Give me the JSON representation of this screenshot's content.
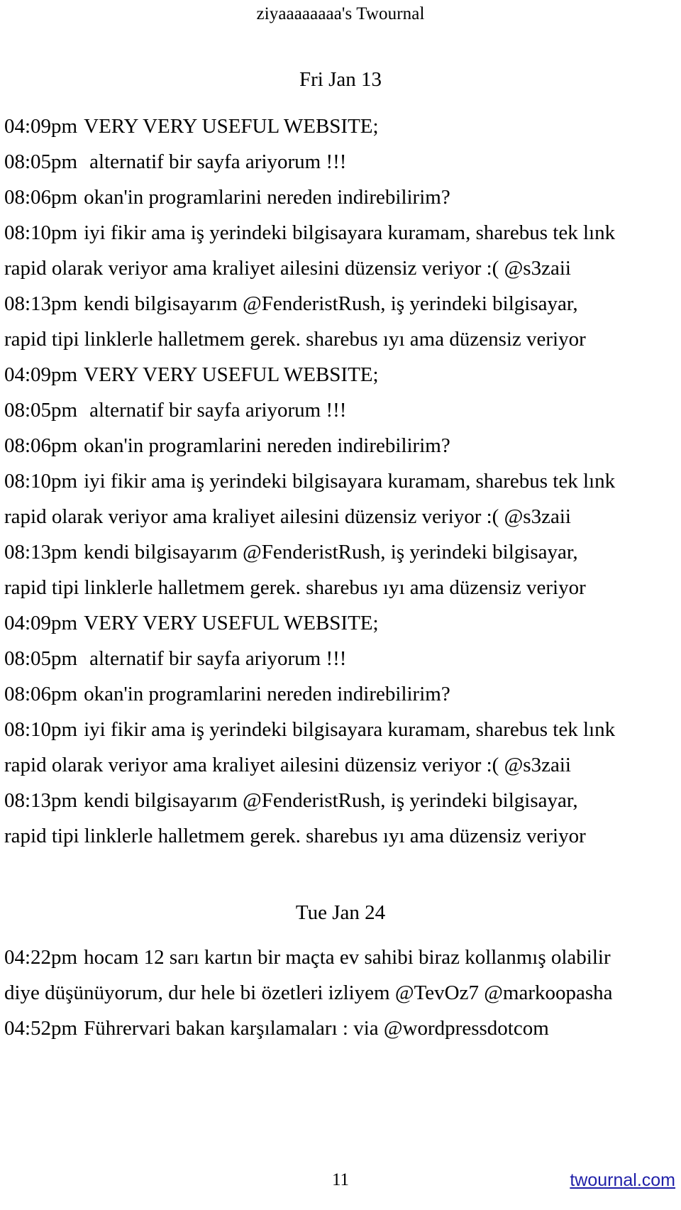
{
  "header": {
    "title": "ziyaaaaaaaa's Twournal"
  },
  "sections": [
    {
      "date": "Fri Jan 13",
      "lines": [
        {
          "time": "04:09pm",
          "text": "VERY VERY USEFUL WEBSITE;"
        },
        {
          "time": "08:05pm",
          "text": "alternatif bir sayfa ariyorum !!!"
        },
        {
          "time": "08:06pm",
          "text": "okan'in programlarini nereden indirebilirim?"
        },
        {
          "time": "08:10pm",
          "text": "iyi fikir ama iş yerindeki bilgisayara kuramam, sharebus tek lınk"
        },
        {
          "time": "",
          "text": "rapid olarak veriyor ama kraliyet ailesini düzensiz veriyor :( @s3zaii"
        },
        {
          "time": "08:13pm",
          "text": "kendi bilgisayarım @FenderistRush, iş yerindeki bilgisayar,"
        },
        {
          "time": "",
          "text": "rapid tipi linklerle halletmem gerek. sharebus ıyı ama düzensiz veriyor"
        },
        {
          "time": "04:09pm",
          "text": "VERY VERY USEFUL WEBSITE;"
        },
        {
          "time": "08:05pm",
          "text": "alternatif bir sayfa ariyorum !!!"
        },
        {
          "time": "08:06pm",
          "text": "okan'in programlarini nereden indirebilirim?"
        },
        {
          "time": "08:10pm",
          "text": "iyi fikir ama iş yerindeki bilgisayara kuramam, sharebus tek lınk"
        },
        {
          "time": "",
          "text": "rapid olarak veriyor ama kraliyet ailesini düzensiz veriyor :( @s3zaii"
        },
        {
          "time": "08:13pm",
          "text": "kendi bilgisayarım @FenderistRush, iş yerindeki bilgisayar,"
        },
        {
          "time": "",
          "text": "rapid tipi linklerle halletmem gerek. sharebus ıyı ama düzensiz veriyor"
        },
        {
          "time": "04:09pm",
          "text": "VERY VERY USEFUL WEBSITE;"
        },
        {
          "time": "08:05pm",
          "text": "alternatif bir sayfa ariyorum !!!"
        },
        {
          "time": "08:06pm",
          "text": "okan'in programlarini nereden indirebilirim?"
        },
        {
          "time": "08:10pm",
          "text": "iyi fikir ama iş yerindeki bilgisayara kuramam, sharebus tek lınk"
        },
        {
          "time": "",
          "text": "rapid olarak veriyor ama kraliyet ailesini düzensiz veriyor :( @s3zaii"
        },
        {
          "time": "08:13pm",
          "text": "kendi bilgisayarım @FenderistRush, iş yerindeki bilgisayar,"
        },
        {
          "time": "",
          "text": "rapid tipi linklerle halletmem gerek. sharebus ıyı ama düzensiz veriyor"
        }
      ]
    },
    {
      "date": "Tue Jan 24",
      "lines": [
        {
          "time": "04:22pm",
          "text": "hocam 12 sarı kartın bir maçta ev sahibi biraz kollanmış olabilir"
        },
        {
          "time": "",
          "text": "diye düşünüyorum, dur hele bi özetleri izliyem @TevOz7 @markoopasha"
        },
        {
          "time": "04:52pm",
          "text": "Führervari bakan karşılamaları : via @wordpressdotcom"
        }
      ]
    }
  ],
  "footer": {
    "page_number": "11",
    "link_label": "twournal.com",
    "link_color": "#1f1fa8"
  }
}
